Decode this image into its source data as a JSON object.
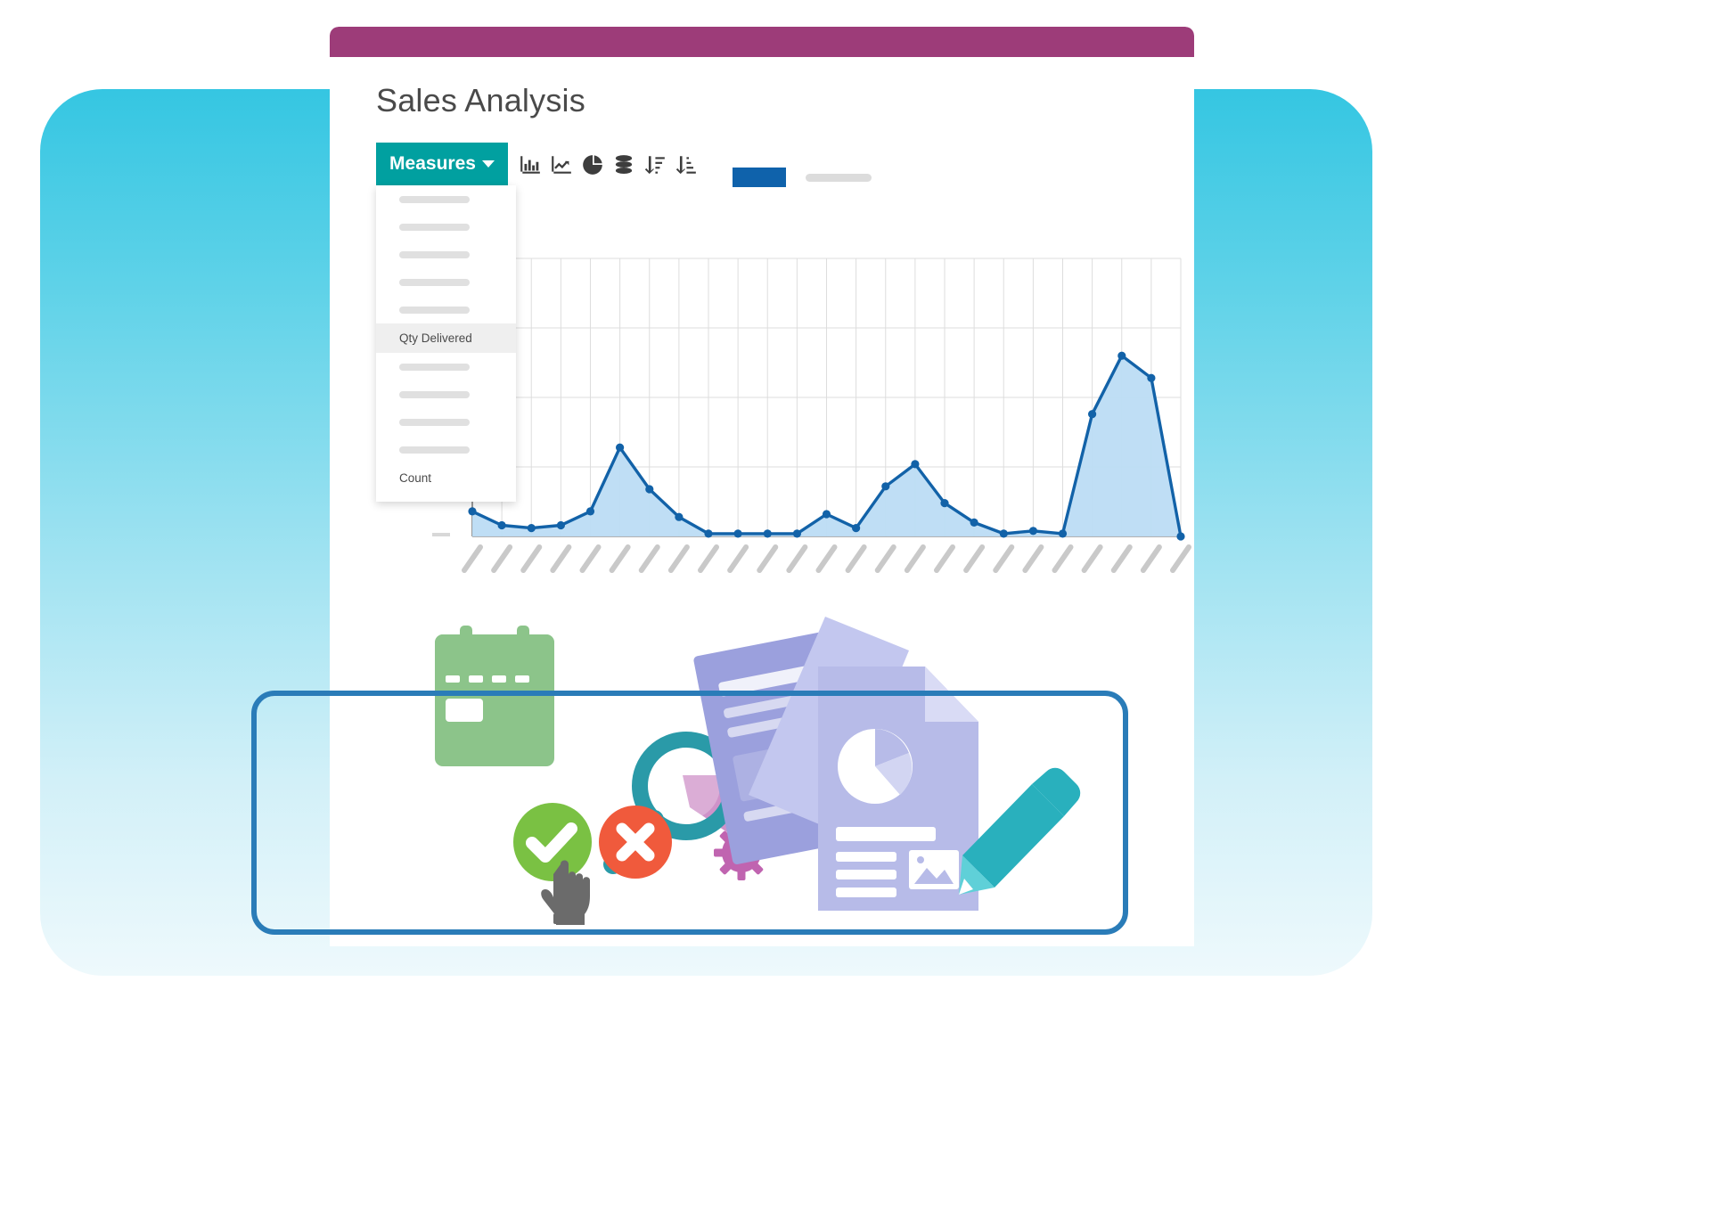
{
  "window": {
    "title_bar_color": "#9d3c79",
    "page_title": "Sales Analysis"
  },
  "toolbar": {
    "measures_label": "Measures",
    "caret_icon": "chevron-down-icon",
    "icons": [
      {
        "name": "bar-chart-icon",
        "label": "Bar chart"
      },
      {
        "name": "line-chart-icon",
        "label": "Line chart"
      },
      {
        "name": "pie-chart-icon",
        "label": "Pie chart"
      },
      {
        "name": "database-icon",
        "label": "Data source"
      },
      {
        "name": "sort-descending-icon",
        "label": "Sort descending"
      },
      {
        "name": "sort-ascending-icon",
        "label": "Sort ascending"
      }
    ]
  },
  "dropdown": {
    "items": [
      {
        "label": "",
        "placeholder": true,
        "selected": false
      },
      {
        "label": "",
        "placeholder": true,
        "selected": false
      },
      {
        "label": "",
        "placeholder": true,
        "selected": false
      },
      {
        "label": "",
        "placeholder": true,
        "selected": false
      },
      {
        "label": "",
        "placeholder": true,
        "selected": false
      },
      {
        "label": "Qty Delivered",
        "placeholder": false,
        "selected": true
      },
      {
        "label": "",
        "placeholder": true,
        "selected": false
      },
      {
        "label": "",
        "placeholder": true,
        "selected": false
      },
      {
        "label": "",
        "placeholder": true,
        "selected": false
      },
      {
        "label": "",
        "placeholder": true,
        "selected": false
      },
      {
        "label": "Count",
        "placeholder": false,
        "selected": false
      }
    ]
  },
  "legend": {
    "series_swatch_color": "#0f62ab",
    "series_label": "",
    "secondary_label": ""
  },
  "colors": {
    "accent_teal": "#01a0a0",
    "title_bar_magenta": "#9d3c79",
    "series_blue": "#1262a8",
    "series_fill": "#bcdcf4",
    "frame_blue": "#2a7cb8",
    "backdrop_cyan": "#35c6e2",
    "backdrop_pale": "#eef9fc",
    "calendar_green": "#8cc48a",
    "check_green": "#7ac143",
    "cross_red": "#f05a3c",
    "doc_purple": "#b7bbe8",
    "pencil_teal": "#29b0bd",
    "magnifier_teal": "#2a9aa8",
    "gear_magenta": "#c064b0"
  },
  "chart_data": {
    "type": "area",
    "title": "",
    "xlabel": "",
    "ylabel": "",
    "grid": true,
    "legend_position": "top-right",
    "series_name": "Qty Delivered",
    "line_color": "#1262a8",
    "fill_color": "#bcdcf4",
    "ylim": [
      0,
      100
    ],
    "x": [
      1,
      2,
      3,
      4,
      5,
      6,
      7,
      8,
      9,
      10,
      11,
      12,
      13,
      14,
      15,
      16,
      17,
      18,
      19,
      20,
      21,
      22,
      23,
      24,
      25
    ],
    "categories": [
      "",
      "",
      "",
      "",
      "",
      "",
      "",
      "",
      "",
      "",
      "",
      "",
      "",
      "",
      "",
      "",
      "",
      "",
      "",
      "",
      "",
      "",
      "",
      "",
      ""
    ],
    "values": [
      9,
      4,
      3,
      4,
      9,
      32,
      17,
      7,
      1,
      1,
      1,
      1,
      8,
      3,
      18,
      26,
      12,
      5,
      1,
      2,
      1,
      44,
      65,
      57,
      0
    ],
    "xtick_marks": 25,
    "xtick_style": "diagonal-dashes"
  },
  "illustration": {
    "items": [
      {
        "name": "calendar-icon",
        "color": "#8cc48a"
      },
      {
        "name": "magnifier-icon",
        "color": "#2a9aa8"
      },
      {
        "name": "gear-icon",
        "color": "#c064b0"
      },
      {
        "name": "check-circle-icon",
        "color": "#7ac143"
      },
      {
        "name": "cursor-hand-icon",
        "color": "#6b6b6b"
      },
      {
        "name": "cross-circle-icon",
        "color": "#f05a3c"
      },
      {
        "name": "document-icon",
        "color": "#b7bbe8"
      },
      {
        "name": "pie-chart-doc-icon",
        "color": "#ffffff"
      },
      {
        "name": "pencil-icon",
        "color": "#29b0bd"
      }
    ]
  }
}
